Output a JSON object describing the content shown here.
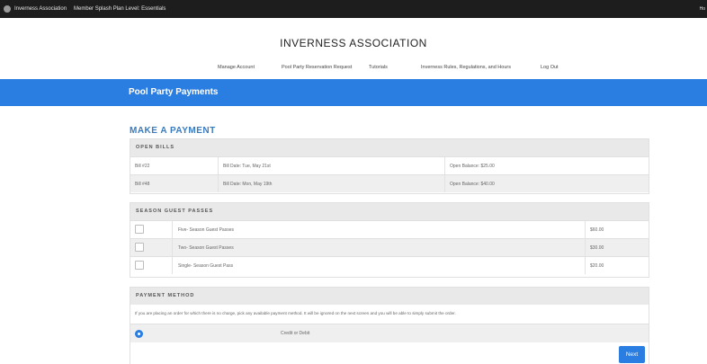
{
  "adminbar": {
    "site_name": "Inverness Association",
    "plan_label": "Member Splash Plan Level: Essentials",
    "right_text": "Ho"
  },
  "site": {
    "title": "INVERNESS ASSOCIATION"
  },
  "nav": {
    "items": [
      "Manage Account",
      "Pool Party Reservation Request",
      "Tutorials",
      "Inverness Rules, Regulations, and Hours",
      "Log Out"
    ]
  },
  "banner": {
    "title": "Pool Party Payments"
  },
  "payment": {
    "heading": "MAKE A PAYMENT",
    "open_bills": {
      "header": "OPEN BILLS",
      "rows": [
        {
          "bill": "Bill #22",
          "date": "Bill Date: Tue, May 21st",
          "balance": "Open Balance: $25.00"
        },
        {
          "bill": "Bill #48",
          "date": "Bill Date: Mon, May 19th",
          "balance": "Open Balance: $40.00"
        }
      ]
    },
    "guest_passes": {
      "header": "SEASON GUEST PASSES",
      "rows": [
        {
          "label": "Five- Season Guest Passes",
          "price": "$60.00"
        },
        {
          "label": "Two- Season Guest Passes",
          "price": "$30.00"
        },
        {
          "label": "Single- Season Guest Pass",
          "price": "$20.00"
        }
      ]
    },
    "method": {
      "header": "PAYMENT METHOD",
      "note": "If you are placing an order for which there is no charge, pick any available payment method. It will be ignored on the next screen and you will be able to simply submit the order.",
      "option_label": "Credit or Debit",
      "selected": true
    },
    "next_label": "Next"
  },
  "colors": {
    "accent": "#2a7de1",
    "heading": "#3a7bbf",
    "adminbar": "#1d1d1d"
  }
}
